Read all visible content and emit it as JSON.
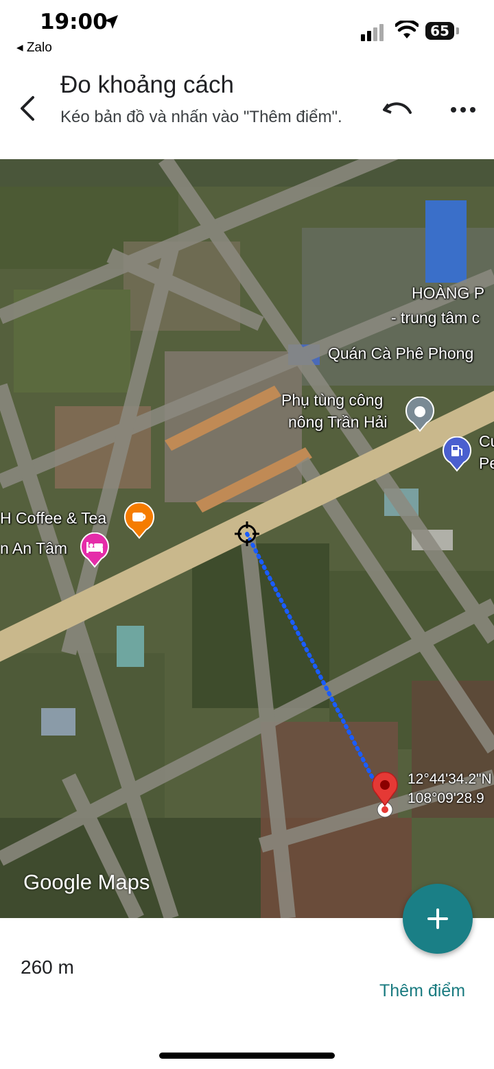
{
  "status_bar": {
    "time": "19:00",
    "back_app": "◂ Zalo",
    "battery": "65"
  },
  "header": {
    "title": "Đo khoảng cách",
    "subtitle": "Kéo bản đồ và nhấn vào \"Thêm điểm\"."
  },
  "map": {
    "labels": {
      "hoang_phat_1": "HOÀNG P",
      "hoang_phat_2": "- trung tâm c",
      "cafe_phong": "Quán Cà Phê Phong",
      "phu_tung_1": "Phụ tùng công",
      "phu_tung_2": "nông Trần Hải",
      "petrol_1": "Cu",
      "petrol_2": "Pe",
      "coffee_tea": "H Coffee & Tea",
      "an_tam": "n An Tâm"
    },
    "pin_coords": {
      "lat": "12°44'34.2\"N",
      "lng": "108°09'28.9"
    },
    "logo": "Google Maps",
    "icons": {
      "cafe": "coffee-cup-icon",
      "hotel": "bed-icon",
      "petrol": "fuel-pump-icon",
      "shop": "place-pin-icon"
    },
    "colors": {
      "measure_line": "#1a5cff",
      "pin_red": "#e53935",
      "cafe_orange": "#f57c00",
      "hotel_pink": "#e52ca9",
      "petrol_blue": "#4a5fcf"
    }
  },
  "bottom": {
    "distance": "260 m",
    "add_point": "Thêm điểm"
  },
  "fab": {
    "icon": "plus-icon",
    "color": "#1a7f86"
  }
}
